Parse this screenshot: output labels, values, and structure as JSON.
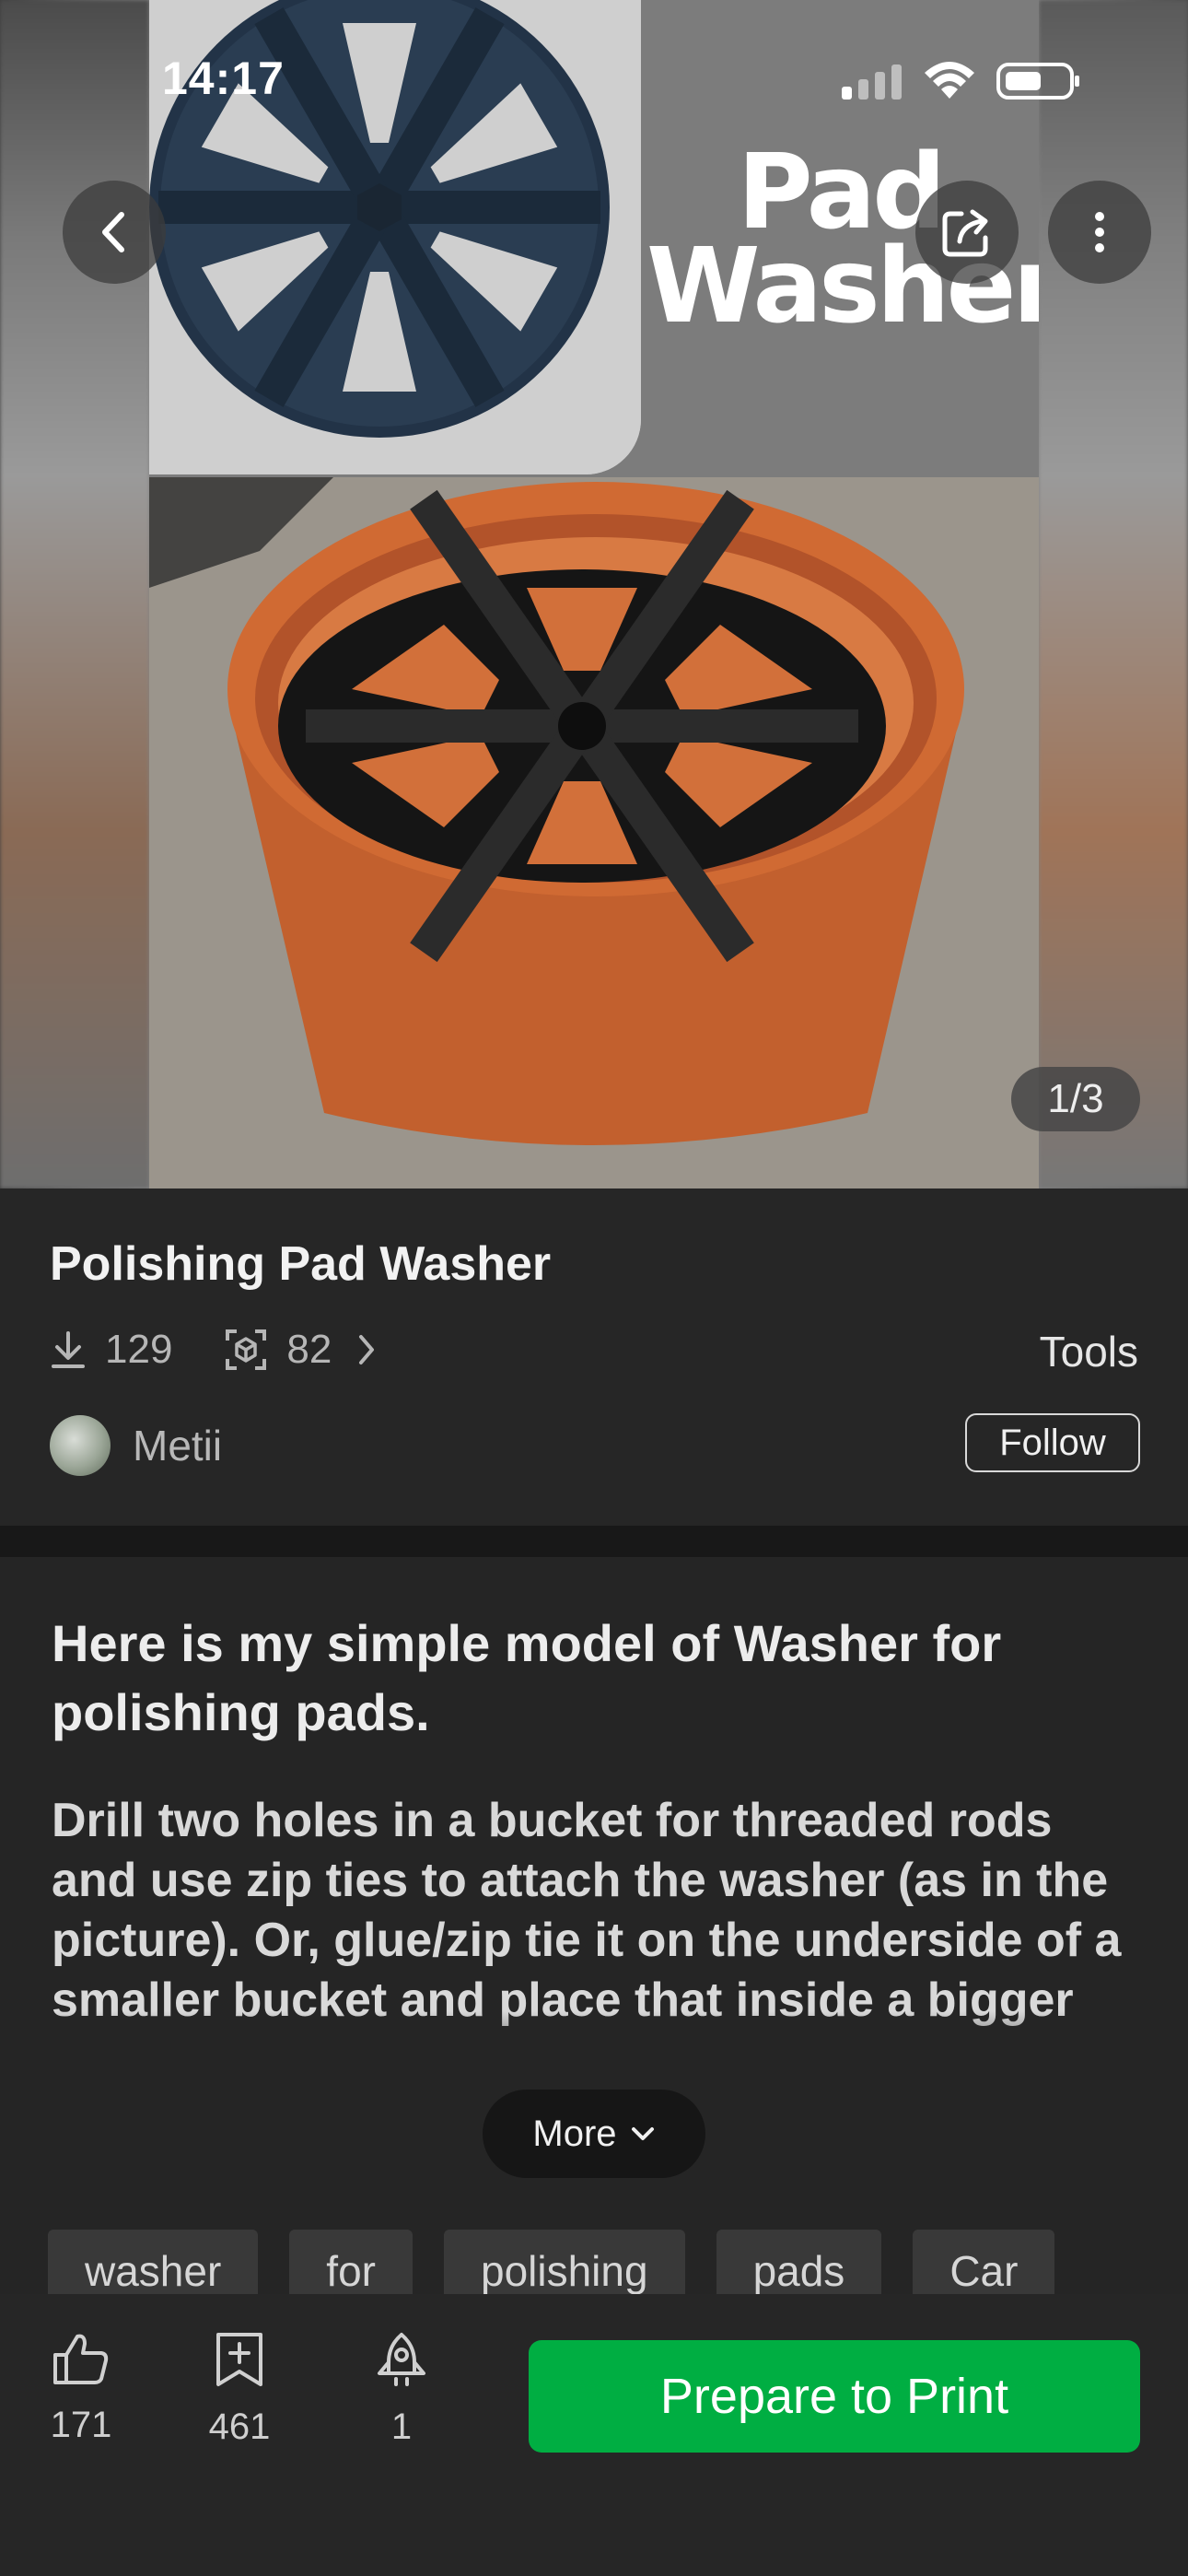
{
  "status_bar": {
    "time": "14:17"
  },
  "hero": {
    "overlay_title_line1": "Pad",
    "overlay_title_line2": "Washer",
    "page_indicator": "1/3"
  },
  "model": {
    "title": "Polishing Pad Washer",
    "downloads": "129",
    "prints": "82",
    "category": "Tools",
    "author": "Metii",
    "follow_label": "Follow"
  },
  "description": {
    "lead": "Here is my simple model of Washer for polishing pads.",
    "body": "Drill two holes in a bucket for threaded rods and use zip ties to attach the washer (as in the picture). Or, glue/zip tie it on the underside of a smaller bucket and place that inside a bigger",
    "more_label": "More"
  },
  "tags": [
    "washer",
    "for",
    "polishing",
    "pads",
    "Car"
  ],
  "actions": {
    "likes": "171",
    "collects": "461",
    "boosts": "1",
    "prepare_label": "Prepare to Print"
  },
  "colors": {
    "accent_green": "#00ae42",
    "background": "#242424"
  }
}
